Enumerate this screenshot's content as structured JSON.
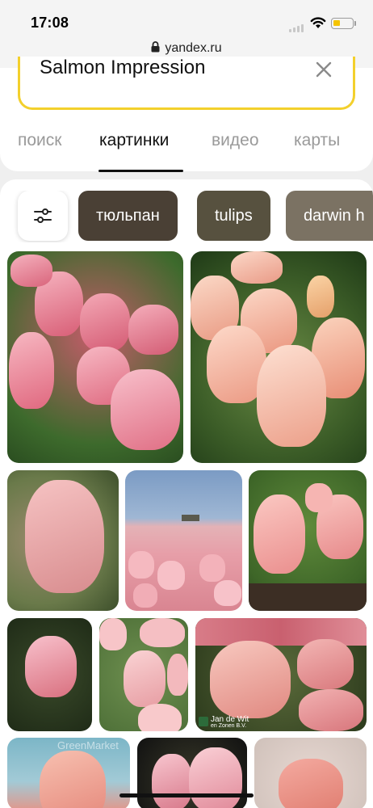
{
  "status": {
    "time": "17:08"
  },
  "browser": {
    "url": "yandex.ru"
  },
  "search": {
    "query": "Salmon Impression"
  },
  "tabs": [
    {
      "label": "поиск"
    },
    {
      "label": "картинки"
    },
    {
      "label": "видео"
    },
    {
      "label": "карты"
    }
  ],
  "active_tab": "картинки",
  "chips": [
    {
      "label": "тюльпан"
    },
    {
      "label": "tulips"
    },
    {
      "label": "darwin h"
    }
  ],
  "images": {
    "watermark_jan": "Jan de Wit",
    "watermark_jan_sub": "en Zonen B.V.",
    "watermark_green": "GreenMarket"
  },
  "colors": {
    "accent": "#f3d02c",
    "chip_1": "#4a4035",
    "chip_2": "#57513f",
    "chip_3": "#7b7263"
  },
  "icons": [
    "lock-icon",
    "wifi-icon",
    "battery-icon",
    "clear-icon",
    "filter-sliders-icon"
  ]
}
